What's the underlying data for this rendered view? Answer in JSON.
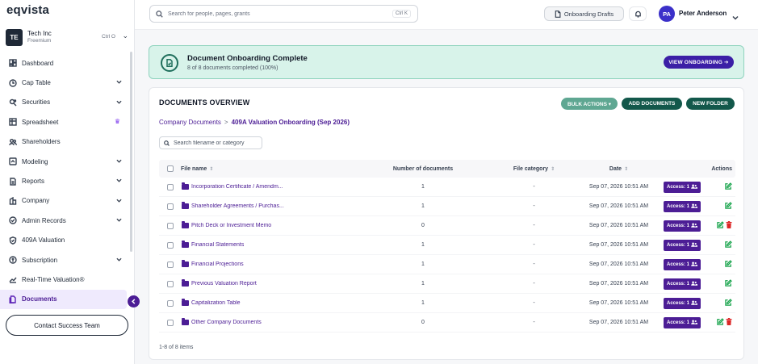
{
  "app": {
    "logo": "eqvista"
  },
  "org": {
    "initials": "TE",
    "name": "Tech Inc",
    "plan": "Freemium",
    "shortcut": "Ctrl O"
  },
  "sidebar": {
    "items": [
      {
        "label": "Dashboard",
        "icon": "dashboard-icon",
        "chevron": false
      },
      {
        "label": "Cap Table",
        "icon": "clock-icon",
        "chevron": true
      },
      {
        "label": "Securities",
        "icon": "securities-icon",
        "chevron": true
      },
      {
        "label": "Spreadsheet",
        "icon": "spreadsheet-icon",
        "chevron": false,
        "crown": true
      },
      {
        "label": "Shareholders",
        "icon": "users-icon",
        "chevron": false
      },
      {
        "label": "Modeling",
        "icon": "modeling-icon",
        "chevron": true
      },
      {
        "label": "Reports",
        "icon": "reports-icon",
        "chevron": true
      },
      {
        "label": "Company",
        "icon": "company-icon",
        "chevron": true
      },
      {
        "label": "Admin Records",
        "icon": "admin-records-icon",
        "chevron": true
      },
      {
        "label": "409A Valuation",
        "icon": "shield-check-icon",
        "chevron": false
      },
      {
        "label": "Subscription",
        "icon": "subscription-icon",
        "chevron": true
      },
      {
        "label": "Real-Time Valuation®",
        "icon": "trend-icon",
        "chevron": false
      },
      {
        "label": "Documents",
        "icon": "documents-icon",
        "chevron": false,
        "active": true
      }
    ],
    "contact_label": "Contact Success Team"
  },
  "header": {
    "search_placeholder": "Search for people, pages, grants",
    "search_shortcut": "Ctrl K",
    "drafts_label": "Onboarding Drafts",
    "user_initials": "PA",
    "user_name": "Peter Anderson"
  },
  "banner": {
    "title": "Document Onboarding Complete",
    "subtitle": "8 of 8 documents completed (100%)",
    "button": "VIEW ONBOARDING ➔"
  },
  "documents": {
    "title": "DOCUMENTS OVERVIEW",
    "bulk_label": "BULK ACTIONS ▾",
    "add_label": "ADD DOCUMENTS",
    "folder_label": "NEW FOLDER",
    "breadcrumb_root": "Company Documents",
    "breadcrumb_sep": ">",
    "breadcrumb_current": "409A Valuation Onboarding (Sep 2026)",
    "search_placeholder": "Search filename or category",
    "columns": {
      "file_name": "File name",
      "count": "Number of documents",
      "category": "File category",
      "date": "Date",
      "actions": "Actions"
    },
    "rows": [
      {
        "name": "Incorporation Certificate / Amendm...",
        "count": "1",
        "category": "-",
        "date": "Sep 07, 2026 10:51 AM",
        "access": "Access: 1",
        "deletable": false
      },
      {
        "name": "Shareholder Agreements / Purchas...",
        "count": "1",
        "category": "-",
        "date": "Sep 07, 2026 10:51 AM",
        "access": "Access: 1",
        "deletable": false
      },
      {
        "name": "Pitch Deck or Investment Memo",
        "count": "0",
        "category": "-",
        "date": "Sep 07, 2026 10:51 AM",
        "access": "Access: 1",
        "deletable": true
      },
      {
        "name": "Financial Statements",
        "count": "1",
        "category": "-",
        "date": "Sep 07, 2026 10:51 AM",
        "access": "Access: 1",
        "deletable": false
      },
      {
        "name": "Financial Projections",
        "count": "1",
        "category": "-",
        "date": "Sep 07, 2026 10:51 AM",
        "access": "Access: 1",
        "deletable": false
      },
      {
        "name": "Previous Valuation Report",
        "count": "1",
        "category": "-",
        "date": "Sep 07, 2026 10:51 AM",
        "access": "Access: 1",
        "deletable": false
      },
      {
        "name": "Capitalization Table",
        "count": "1",
        "category": "-",
        "date": "Sep 07, 2026 10:51 AM",
        "access": "Access: 1",
        "deletable": false
      },
      {
        "name": "Other Company Documents",
        "count": "0",
        "category": "-",
        "date": "Sep 07, 2026 10:51 AM",
        "access": "Access: 1",
        "deletable": true
      }
    ],
    "footer": "1-8 of 8 items"
  },
  "colors": {
    "accent": "#4c1d95",
    "teal_dark": "#13584b",
    "teal_light": "#5fa792",
    "banner_bg": "#d8f3ea"
  }
}
